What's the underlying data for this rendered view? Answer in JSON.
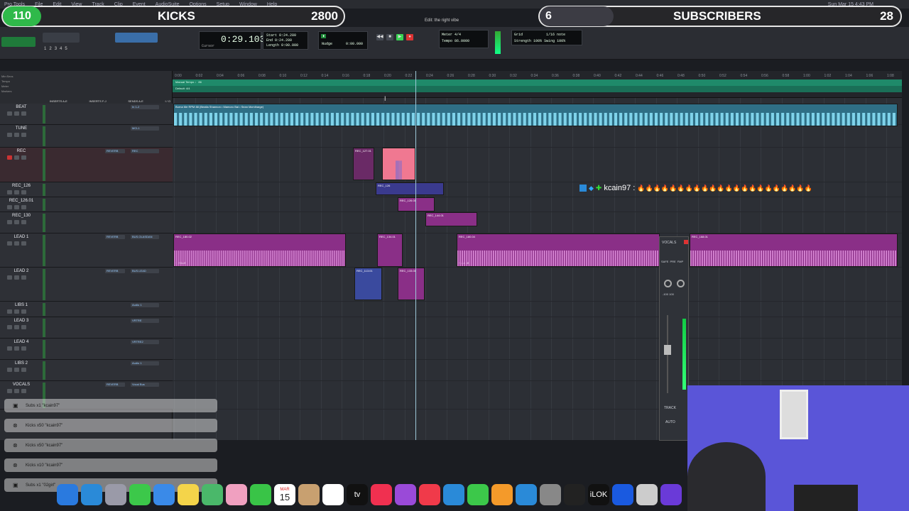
{
  "menubar": {
    "items": [
      "Pro Tools",
      "File",
      "Edit",
      "View",
      "Track",
      "Clip",
      "Event",
      "AudioSuite",
      "Options",
      "Setup",
      "Window",
      "Help"
    ],
    "clock": "Sun Mar 15  4:43 PM"
  },
  "overlay": {
    "kicks_count": "110",
    "kicks_label": "KICKS",
    "kicks_goal": "2800",
    "subs_count": "6",
    "subs_label": "SUBSCRIBERS",
    "subs_goal": "28"
  },
  "window": {
    "title": "Edit: the right vibe"
  },
  "toolbar": {
    "counter_main": "0:29.103",
    "start_label": "Start",
    "end_label": "End",
    "length_label": "Length",
    "start_val": "0:24.280",
    "end_val": "0:24.280",
    "length_val": "0:00.000",
    "cursor_label": "Cursor",
    "nudge_label": "Nudge",
    "nudge_val": "0:00.000",
    "grid_label": "Grid",
    "grid_val": "1/16 note",
    "strength_label": "Strength",
    "strength_val": "100%",
    "swing_label": "Swing",
    "swing_val": "100%",
    "meter_label": "Meter",
    "tempo_label": "Tempo",
    "meter_val": "4/4",
    "tempo_val": "86.0000",
    "numbers": [
      "1",
      "2",
      "3",
      "4",
      "5"
    ]
  },
  "rulers": {
    "rows": [
      "Min:Secs",
      "Tempo",
      "Meter",
      "Markers"
    ],
    "ticks": [
      "0:00",
      "0:02",
      "0:04",
      "0:06",
      "0:08",
      "0:10",
      "0:12",
      "0:14",
      "0:16",
      "0:18",
      "0:20",
      "0:22",
      "0:24",
      "0:26",
      "0:28",
      "0:30",
      "0:32",
      "0:34",
      "0:36",
      "0:38",
      "0:40",
      "0:42",
      "0:44",
      "0:46",
      "0:48",
      "0:50",
      "0:52",
      "0:54",
      "0:56",
      "0:58",
      "1:00",
      "1:02",
      "1:04",
      "1:06",
      "1:08"
    ],
    "tempo_text": "Manual Tempo  ♩ 86",
    "meter_text": "Default: 4/4"
  },
  "mixer_headers": [
    "INSERTS A-E",
    "INSERTS F-J",
    "SENDS A-E",
    "I / O"
  ],
  "tracks": [
    {
      "name": "BEAT",
      "send": "",
      "io": "In 1-2"
    },
    {
      "name": "TUNE",
      "send": "",
      "io": "MCL1"
    },
    {
      "name": "REC",
      "send": "REVERB",
      "io": "REC"
    },
    {
      "name": "REC_126",
      "send": "",
      "io": ""
    },
    {
      "name": "REC_126.01",
      "send": "",
      "io": ""
    },
    {
      "name": "REC_130",
      "send": "",
      "io": ""
    },
    {
      "name": "LEAD 1",
      "send": "REVERB",
      "io": "BUS.OLASDAN"
    },
    {
      "name": "LEAD 2",
      "send": "REVERB",
      "io": "BUS.LEAD"
    },
    {
      "name": "LIBS 1",
      "send": "",
      "io": "Audio 1"
    },
    {
      "name": "LEAD 3",
      "send": "",
      "io": "VRTRE"
    },
    {
      "name": "LEAD 4",
      "send": "",
      "io": "VRTRE2"
    },
    {
      "name": "LIBS 2",
      "send": "",
      "io": "Audio 1"
    },
    {
      "name": "VOCALS",
      "send": "REVERB",
      "io": "Vocal Bus"
    }
  ],
  "clips": {
    "beat": "Burna Me RPM 88 (Beatla Shannon • Mamoro Bai • Sean Mcmiharge)",
    "rec_127": "REC_127.01",
    "rec_126": "REC_126",
    "rec_126_01": "REC_126.01",
    "rec_144": "REC_144.01",
    "lead1_a": "REC_180.02",
    "lead1_b": "REC_134.01",
    "lead1_c": "REC_180.04",
    "lead1_d": "REC_168.01",
    "lead2_a": "REC_113.01",
    "lead2_b": "REC_133.01",
    "gain_labels": [
      "+ 0 dB",
      "+ 2.6 dB",
      "+ 0 dB",
      "+ 2.6 dB"
    ]
  },
  "chat": {
    "user": "kcain97",
    "sep": ":",
    "message": "🔥🔥🔥🔥🔥🔥🔥🔥🔥🔥🔥🔥🔥🔥🔥🔥🔥🔥🔥🔥🔥🔥"
  },
  "strip": {
    "name": "VOCALS",
    "safe": "SAFE",
    "pre": "PRE",
    "fmp": "FMP",
    "vol": "-100",
    "pan": "100",
    "btn_track": "TRACK",
    "btn_auto": "AUTO"
  },
  "alerts": [
    "Subs x1 \"kcain97\"",
    "Kicks x50 \"kcain97\"",
    "Kicks x50 \"kcain97\"",
    "Kicks x10 \"kcain97\"",
    "Subs x1 \"02girl\""
  ],
  "dock": {
    "calendar_month": "MAR",
    "calendar_day": "15",
    "apps": [
      "Finder",
      "Safari",
      "Launchpad",
      "Messages",
      "Mail",
      "Notes",
      "Maps",
      "Photos",
      "FaceTime",
      "Calendar",
      "Contacts",
      "Reminders",
      "Apple TV",
      "Music",
      "Podcasts",
      "News",
      "Keynote",
      "Numbers",
      "Pages",
      "App Store",
      "System Settings",
      "Logic",
      "iLok",
      "Cortana",
      "Cleaner",
      "Pro Tools"
    ],
    "ilok_label": "iLOK",
    "appletv_label": "tv"
  },
  "colors": {
    "accent_green": "#39d353",
    "clip_purple": "#8a2f87",
    "clip_blue": "#3a3a8e",
    "clip_pink": "#f07891",
    "beat_teal": "#3a8ea6",
    "tempo_green": "#1f8a6a"
  }
}
